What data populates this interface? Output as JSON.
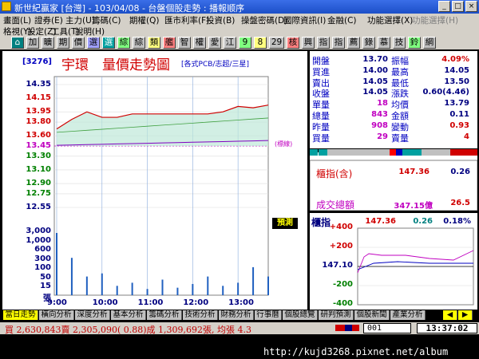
{
  "window": {
    "title": "新世紀贏家 [台灣] - 103/04/08 - 台盤個股走勢 : 播報顺序"
  },
  "menubar": {
    "row1": [
      "畫面(L)",
      "證券(E)",
      "主力(U)",
      "籌碼(C)",
      "期權(Q)",
      "匯市利率(F)",
      "投資(B)",
      "操盤密碼(D)",
      "國際資訊(I)",
      "金融(C)",
      "功能選擇(X)",
      "功能選擇(H)"
    ],
    "row2": [
      "格視(Y)",
      "設定(Z)",
      "工具(T)",
      "說明(H)"
    ]
  },
  "toolbar": {
    "buttons": [
      "⌂",
      "加",
      "曠",
      "期",
      "價",
      "選",
      "選",
      "綜",
      "綜",
      "類",
      "艦",
      "智",
      "權",
      "愛",
      "江",
      "9",
      "8",
      "29",
      "核",
      "興",
      "指",
      "指",
      "薦",
      "錄",
      "慕",
      "技",
      "鈴",
      "綱"
    ]
  },
  "chart": {
    "code": "[3276]",
    "stock_name": "宇環",
    "title": "量價走勢圖",
    "category": "[各式PCB/志超/三星]",
    "annotation": "(標線)",
    "preview_label": "預測",
    "price_ticks": [
      "14.35",
      "14.15",
      "13.95",
      "13.80",
      "13.60",
      "13.45",
      "13.30",
      "13.10",
      "12.90",
      "12.75",
      "12.55"
    ],
    "vol_ticks": [
      "3,000",
      "1,000",
      "600",
      "300",
      "100",
      "50",
      "15",
      "張"
    ],
    "time_ticks": [
      "9:00",
      "10:00",
      "11:00",
      "12:00",
      "13:00"
    ],
    "colors": {
      "up": "#d00000",
      "down": "#008000",
      "ref": "#c000c0",
      "area": "#bfe8d8"
    }
  },
  "chart_data": {
    "type": "line",
    "title": "量價走勢圖",
    "xlabel": "",
    "ylabel": "",
    "x": [
      "9:00",
      "9:20",
      "9:40",
      "10:00",
      "10:20",
      "10:40",
      "11:00",
      "11:20",
      "11:40",
      "12:00",
      "12:20",
      "12:40",
      "13:00",
      "13:20",
      "13:30"
    ],
    "ylim": [
      12.55,
      14.35
    ],
    "series": [
      {
        "values": [
          13.7,
          13.84,
          13.95,
          13.87,
          13.87,
          13.92,
          13.92,
          13.92,
          13.92,
          13.92,
          13.92,
          13.95,
          14.03,
          14.01,
          14.05
        ]
      }
    ],
    "reference": 13.45
  },
  "quote": {
    "rows": [
      {
        "l1": "開盤",
        "v1": "13.70",
        "c1": "navy",
        "l2": "振幅",
        "v2": "4.09%",
        "c2": "red"
      },
      {
        "l1": "買進",
        "v1": "14.00",
        "c1": "navy",
        "l2": "最高",
        "v2": "14.05",
        "c2": "navy"
      },
      {
        "l1": "賣出",
        "v1": "14.05",
        "c1": "navy",
        "l2": "最低",
        "v2": "13.50",
        "c2": "navy"
      },
      {
        "l1": "收盤",
        "v1": "14.05",
        "c1": "navy",
        "l2": "漲跌",
        "v2": "0.60(4.46)",
        "c2": "navy"
      },
      {
        "l1": "單量",
        "v1": "18",
        "c1": "mag",
        "l2": "均價",
        "v2": "13.79",
        "c2": "navy"
      },
      {
        "l1": "總量",
        "v1": "843",
        "c1": "mag",
        "l2": "金額",
        "v2": "0.11",
        "c2": "navy"
      },
      {
        "l1": "昨量",
        "v1": "908",
        "c1": "mag",
        "l2": "變動",
        "v2": "0.93",
        "c2": "red"
      },
      {
        "l1": "買量",
        "v1": "29",
        "c1": "mag",
        "l2": "賣量",
        "v2": "4",
        "c2": "red"
      }
    ],
    "index_label": "櫃指(含)",
    "index_value": "147.36",
    "index_change": "0.26",
    "turnover_label": "成交總額",
    "turnover_value": "347.15億",
    "turnover_change": "26.5",
    "mini_label": "櫃指",
    "mini_value": "147.36",
    "mini_change": "0.26",
    "mini_pct": "0.18%",
    "mini_ticks": [
      "+400",
      "+200",
      "147.10",
      "-200",
      "-400"
    ]
  },
  "bottom_tabs": [
    "當日走勢",
    "橫向分析",
    "深度分析",
    "基本分析",
    "籌碼分析",
    "技術分析",
    "財務分析",
    "行事曆",
    "個股總覽",
    "研判預測",
    "個股新聞",
    "產業分析"
  ],
  "status": {
    "text": "買 2,630,843賣 2,305,090( 0.88)成 1,309,692張, 均張 4.3",
    "page": "001",
    "clock": "13:37:02"
  },
  "watermark": "http://kujd3268.pixnet.net/album"
}
